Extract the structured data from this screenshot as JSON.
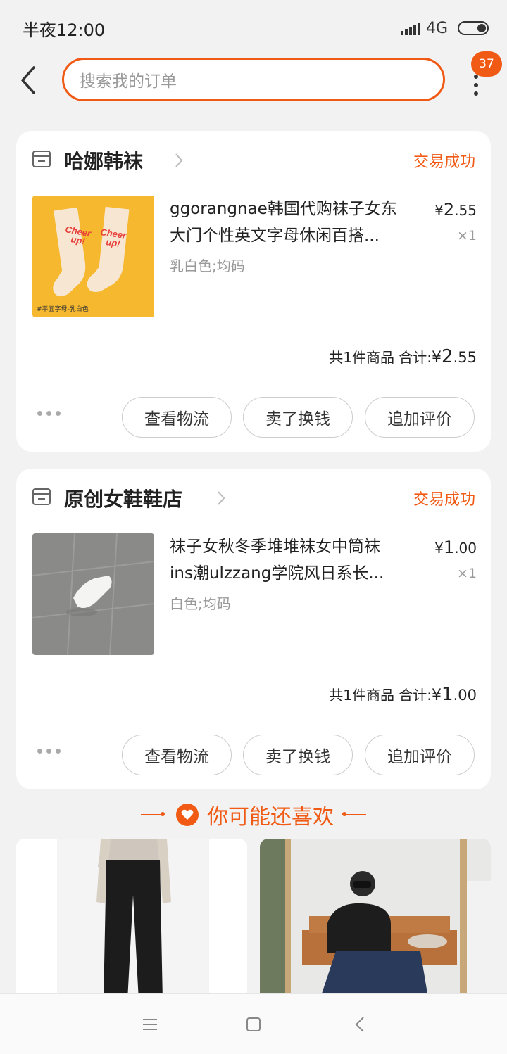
{
  "status_bar": {
    "time": "半夜12:00",
    "network": "4G"
  },
  "header": {
    "search_placeholder": "搜索我的订单",
    "badge_count": "37"
  },
  "accent_color": "#f05a14",
  "orders": [
    {
      "shop_name": "哈娜韩袜",
      "status": "交易成功",
      "product_title_line1": "ggorangnae韩国代购袜子女东",
      "product_title_line2": "大门个性英文字母休闲百搭...",
      "spec": "乳白色;均码",
      "price_symbol": "¥",
      "price_int": "2",
      "price_dec": ".55",
      "qty": "×1",
      "total_label": "共1件商品  合计:",
      "total_symbol": "¥",
      "total_int": "2",
      "total_dec": ".55",
      "image_text": "#平面字母-乳白色",
      "sock_text_1": "Cheer",
      "sock_text_2": "up!",
      "actions": [
        "查看物流",
        "卖了换钱",
        "追加评价"
      ]
    },
    {
      "shop_name": "原创女鞋鞋店",
      "status": "交易成功",
      "product_title_line1": "袜子女秋冬季堆堆袜女中筒袜",
      "product_title_line2": "ins潮ulzzang学院风日系长...",
      "spec": "白色;均码",
      "price_symbol": "¥",
      "price_int": "1",
      "price_dec": ".00",
      "qty": "×1",
      "total_label": "共1件商品  合计:",
      "total_symbol": "¥",
      "total_int": "1",
      "total_dec": ".00",
      "actions": [
        "查看物流",
        "卖了换钱",
        "追加评价"
      ]
    }
  ],
  "recommend": {
    "title": "你可能还喜欢"
  }
}
